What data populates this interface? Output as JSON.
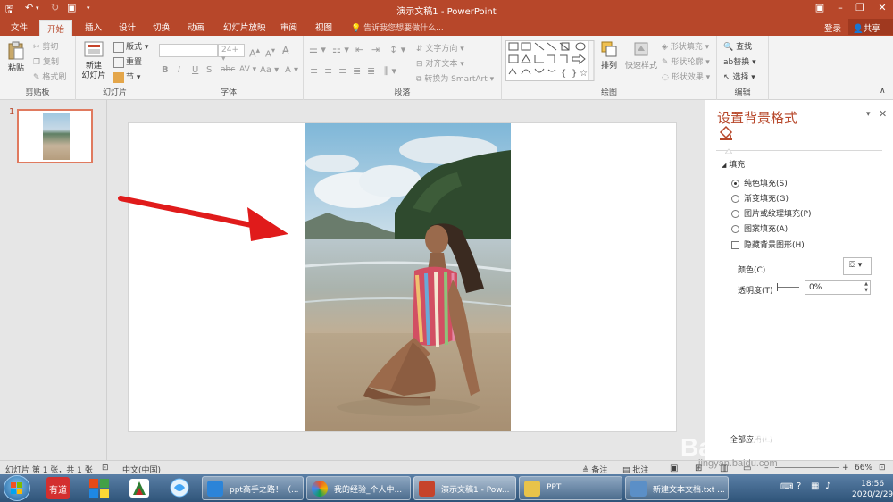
{
  "title_bar": {
    "title": "演示文稿1 - PowerPoint"
  },
  "tabs": [
    "文件",
    "开始",
    "插入",
    "设计",
    "切换",
    "动画",
    "幻灯片放映",
    "审阅",
    "视图"
  ],
  "tell_me": "告诉我您想要做什么...",
  "account": {
    "login": "登录",
    "share": "共享"
  },
  "ribbon": {
    "clipboard": {
      "paste": "粘贴",
      "cut": "剪切",
      "copy": "复制",
      "format_painter": "格式刷",
      "label": "剪贴板"
    },
    "slides": {
      "new_slide_1": "新建",
      "new_slide_2": "幻灯片",
      "layout": "版式",
      "reset": "重置",
      "section": "节",
      "label": "幻灯片"
    },
    "font": {
      "size": "24+",
      "bold": "B",
      "italic": "I",
      "underline": "U",
      "strike": "S",
      "spacing": "AV",
      "case": "Aa",
      "label": "字体"
    },
    "paragraph": {
      "text_direction": "文字方向",
      "align_text": "对齐文本",
      "smartart": "转换为 SmartArt",
      "label": "段落"
    },
    "drawing": {
      "arrange": "排列",
      "quick_styles": "快速样式",
      "shape_fill": "形状填充",
      "shape_outline": "形状轮廓",
      "shape_effects": "形状效果",
      "label": "绘图"
    },
    "editing": {
      "find": "查找",
      "replace": "替换",
      "select": "选择",
      "label": "编辑"
    }
  },
  "thumbnails": {
    "slide_number": "1"
  },
  "format_pane": {
    "title": "设置背景格式",
    "section": "填充",
    "options": [
      {
        "label": "纯色填充(S)",
        "selected": true
      },
      {
        "label": "渐变填充(G)",
        "selected": false
      },
      {
        "label": "图片或纹理填充(P)",
        "selected": false
      },
      {
        "label": "图案填充(A)",
        "selected": false
      }
    ],
    "hide_bg_graphics": "隐藏背景图形(H)",
    "color_label": "颜色(C)",
    "transparency_label": "透明度(T)",
    "transparency_value": "0%",
    "apply_all_partial": "全部应用(L)"
  },
  "status_bar": {
    "slide_info": "幻灯片 第 1 张，共 1 张",
    "language": "中文(中国)",
    "notes": "备注",
    "comments": "批注",
    "zoom": "66%"
  },
  "taskbar": {
    "tasks": [
      {
        "label": "ppt高手之路！（...",
        "color": "#2c84d8"
      },
      {
        "label": "我的经验_个人中...",
        "color": "#e8572a"
      },
      {
        "label": "演示文稿1 - Pow...",
        "color": "#c6432a"
      },
      {
        "label": "PPT",
        "color": "#e8c34a"
      },
      {
        "label": "新建文本文档.txt ...",
        "color": "#5b8fc7"
      }
    ],
    "time": "18:56",
    "date": "2020/2/29"
  },
  "watermark": {
    "text": "Baidu经验",
    "url": "jingyan.baidu.com"
  },
  "colors": {
    "accent": "#b7472a",
    "arrow": "#e01b1b"
  }
}
